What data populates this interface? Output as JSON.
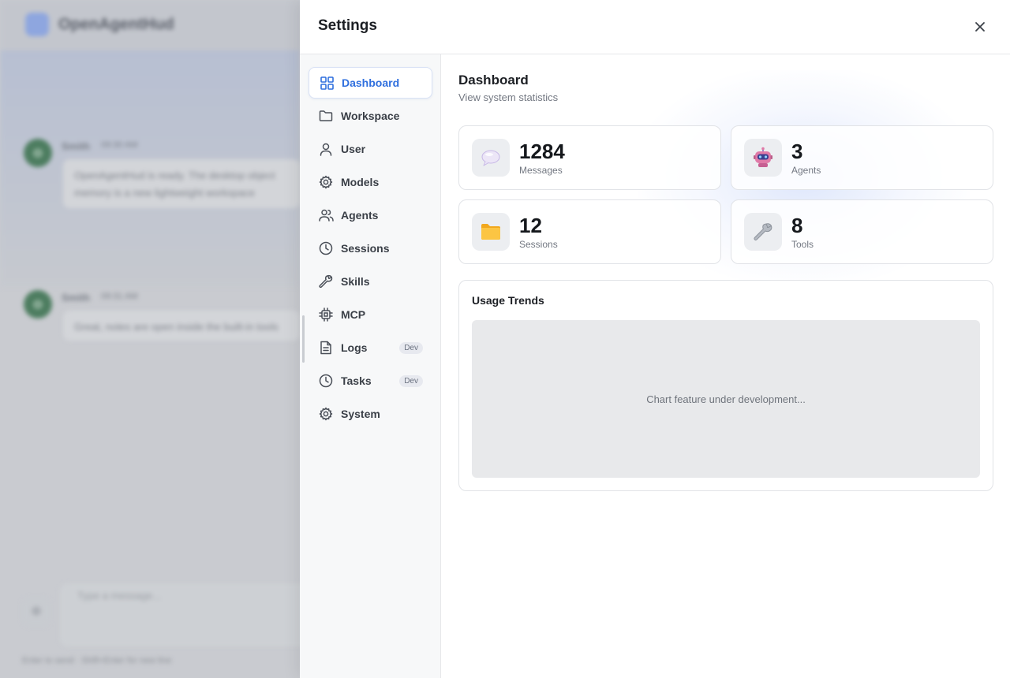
{
  "background_app": {
    "title": "OpenAgentHud",
    "messages": [
      {
        "avatar": "O",
        "name": "Smith",
        "time": "09:30 AM",
        "text": "OpenAgentHud is ready. The desktop object memory is a new lightweight workspace"
      },
      {
        "avatar": "O",
        "name": "Smith",
        "time": "09:31 AM",
        "text": "Great, notes are open inside the built-in tools"
      }
    ],
    "input_placeholder": "Type a message...",
    "footnote": "Enter to send · Shift+Enter for new line"
  },
  "settings": {
    "title": "Settings",
    "close_icon": "close-icon"
  },
  "sidebar": {
    "items": [
      {
        "label": "Dashboard",
        "icon": "grid-icon",
        "active": true
      },
      {
        "label": "Workspace",
        "icon": "folder-icon"
      },
      {
        "label": "User",
        "icon": "user-icon"
      },
      {
        "label": "Models",
        "icon": "gear-icon"
      },
      {
        "label": "Agents",
        "icon": "users-icon"
      },
      {
        "label": "Sessions",
        "icon": "clock-icon"
      },
      {
        "label": "Skills",
        "icon": "wrench-icon"
      },
      {
        "label": "MCP",
        "icon": "chip-icon"
      },
      {
        "label": "Logs",
        "icon": "document-icon",
        "badge": "Dev"
      },
      {
        "label": "Tasks",
        "icon": "clock-icon",
        "badge": "Dev"
      },
      {
        "label": "System",
        "icon": "gear-icon"
      }
    ]
  },
  "main": {
    "title": "Dashboard",
    "subtitle": "View system statistics",
    "stats": [
      {
        "value": "1284",
        "label": "Messages",
        "icon": "speech-bubble-icon"
      },
      {
        "value": "3",
        "label": "Agents",
        "icon": "robot-icon"
      },
      {
        "value": "12",
        "label": "Sessions",
        "icon": "folder-icon"
      },
      {
        "value": "8",
        "label": "Tools",
        "icon": "wrench-icon"
      }
    ],
    "usage": {
      "title": "Usage Trends",
      "placeholder": "Chart feature under development..."
    }
  },
  "colors": {
    "accent": "#2f6fde",
    "active_border": "#d9e2f5",
    "folder_yellow": "#f6b93b",
    "robot_pink": "#e07aa8"
  }
}
